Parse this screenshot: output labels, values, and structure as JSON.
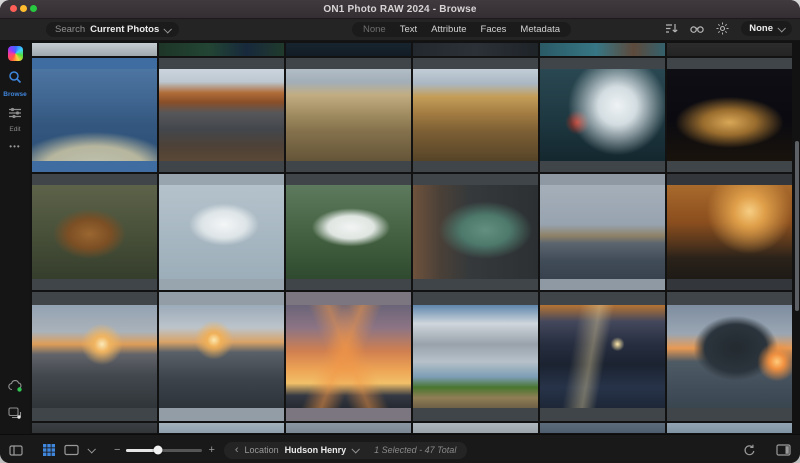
{
  "window": {
    "title": "ON1 Photo RAW 2024 - Browse"
  },
  "toolbar": {
    "search_label": "Search",
    "search_scope": "Current Photos",
    "filter_tabs": [
      "None",
      "Text",
      "Attribute",
      "Faces",
      "Metadata"
    ],
    "filter_tabs_selected": "None",
    "filter_preset_value": "None",
    "icons": [
      "sort-icon",
      "compare-icon",
      "lights-out-icon"
    ]
  },
  "sidebar": {
    "modules": [
      {
        "label": "Browse",
        "active": true
      },
      {
        "label": "Edit",
        "active": false
      }
    ],
    "more_label": "•••",
    "bottom_icons": [
      "cloud-sync-icon",
      "versions-icon"
    ]
  },
  "grid": {
    "top_row": [
      {
        "id": "snow-skier",
        "subject": "Snowy slope with skier"
      },
      {
        "id": "peacock-foliage",
        "subject": "Dark green foliage"
      },
      {
        "id": "dark-blue",
        "subject": "Dark blue scene"
      },
      {
        "id": "ferris-structure",
        "subject": "Dark structure"
      },
      {
        "id": "teal-portrait",
        "subject": "Teal portrait scene"
      },
      {
        "id": "gray-blur",
        "subject": "Gray scene"
      }
    ],
    "rows": [
      [
        {
          "id": "dunes-people",
          "subject": "People on sand dune against blue mountains",
          "selected": true
        },
        {
          "id": "badwater-reflection",
          "subject": "Desert basin reflection at sunrise"
        },
        {
          "id": "sand-ripples",
          "subject": "Rippled sand dunes"
        },
        {
          "id": "badlands-ridges",
          "subject": "Golden badlands ridges"
        },
        {
          "id": "boy-wave-splash",
          "subject": "Boy in red shirt by splashing wave"
        },
        {
          "id": "fountain-night",
          "subject": "Illuminated fountain at night"
        }
      ],
      [
        {
          "id": "owl-flight",
          "subject": "Owl in flight"
        },
        {
          "id": "egret-landing",
          "subject": "White egret landing"
        },
        {
          "id": "egret-flight",
          "subject": "White egret flying over green"
        },
        {
          "id": "havana-car",
          "subject": "Vintage green car on wet street"
        },
        {
          "id": "morro-lighthouse",
          "subject": "Fortress lighthouse by the sea"
        },
        {
          "id": "sunset-sea-rock",
          "subject": "Orange sunset over sea rock"
        }
      ],
      [
        {
          "id": "beach-sunstar",
          "subject": "Beach sea stacks with sunstar"
        },
        {
          "id": "photographers-haystack",
          "subject": "Photographers at Haystack Rock sunset"
        },
        {
          "id": "sun-rays-clouds",
          "subject": "Orange crepuscular rays at sunset"
        },
        {
          "id": "field-storm-clouds",
          "subject": "Storm clouds over green field"
        },
        {
          "id": "lighthouse-beam",
          "subject": "Lighthouse beam at dusk"
        },
        {
          "id": "second-beach-sunset",
          "subject": "Sea stack beach at sunset"
        }
      ]
    ],
    "bottom_row": [
      {
        "id": "dark-beach",
        "subject": "Dark beach"
      },
      {
        "id": "sky-sliver-1",
        "subject": "Blue sky"
      },
      {
        "id": "gray-sliver",
        "subject": "Gray sky"
      },
      {
        "id": "tan-sliver",
        "subject": "Pale sky"
      },
      {
        "id": "blue-sliver",
        "subject": "Blue gray scene"
      },
      {
        "id": "sky-sliver-2",
        "subject": "Blue sky scene"
      }
    ]
  },
  "statusbar": {
    "location_label": "Location",
    "location_value": "Hudson Henry",
    "selection_info": "1 Selected - 47 Total"
  },
  "colors": {
    "accent_blue": "#3f86dd",
    "selection_highlight": "#4a86c8",
    "sync_green": "#30c553",
    "traffic_red": "#ff5f57",
    "traffic_yellow": "#febc2e",
    "traffic_green": "#28c840"
  }
}
